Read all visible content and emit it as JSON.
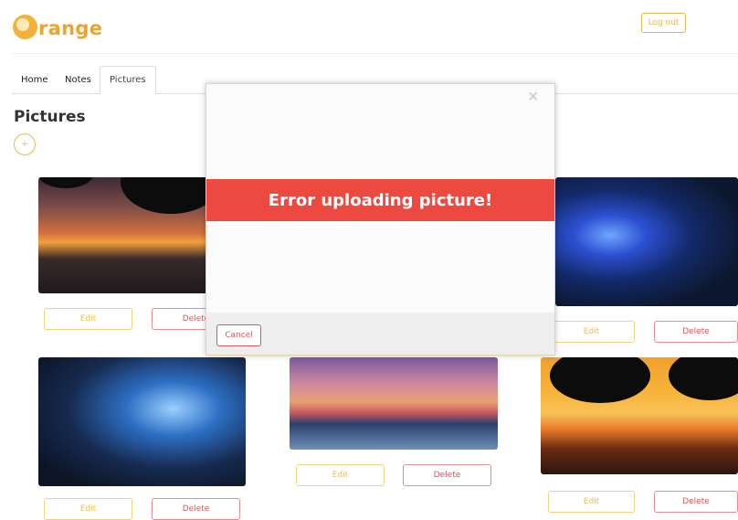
{
  "brand": {
    "logo_text": "range",
    "accent": "#e9a52d"
  },
  "header": {
    "logout_label": "Log out"
  },
  "tabs": [
    {
      "label": "Home"
    },
    {
      "label": "Notes"
    },
    {
      "label": "Pictures"
    }
  ],
  "page": {
    "title": "Pictures",
    "add_label": "+"
  },
  "cards": [
    {
      "edit_label": "Edit",
      "delete_label": "Delete"
    },
    {
      "edit_label": "Edit",
      "delete_label": "Delete"
    },
    {
      "edit_label": "Edit",
      "delete_label": "Delete"
    },
    {
      "edit_label": "Edit",
      "delete_label": "Delete"
    },
    {
      "edit_label": "Edit",
      "delete_label": "Delete"
    }
  ],
  "modal": {
    "close_glyph": "×",
    "error_text": "Error uploading picture!",
    "cancel_label": "Cancel",
    "error_color": "#ec4a41"
  }
}
